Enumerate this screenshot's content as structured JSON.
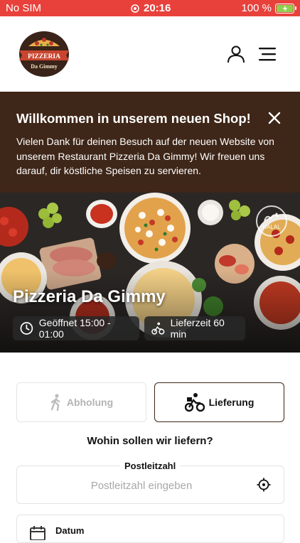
{
  "status_bar": {
    "carrier": "No SIM",
    "time": "20:16",
    "battery": "100 %"
  },
  "header": {
    "logo_top_text": "PIZZERIA",
    "logo_bottom_text": "Da Gimmy"
  },
  "banner": {
    "title": "Willkommen in unserem neuen Shop!",
    "text": "Vielen Dank für deinen Besuch auf der neuen Website von unserem Restaurant Pizzeria Da Gimmy! Wir freuen uns darauf, dir köstliche Speisen zu servieren."
  },
  "hero": {
    "restaurant_name": "Pizzeria Da Gimmy",
    "opening_hours": "Geöffnet 15:00 - 01:00",
    "delivery_time": "Lieferzeit 60 min",
    "badge_text": "HALAL"
  },
  "order_mode": {
    "pickup_label": "Abholung",
    "delivery_label": "Lieferung",
    "selected": "delivery"
  },
  "delivery_question": "Wohin sollen wir liefern?",
  "postal_code": {
    "label": "Postleitzahl",
    "placeholder": "Postleitzahl eingeben",
    "value": ""
  },
  "date_field": {
    "label": "Datum"
  },
  "colors": {
    "status_bar": "#e8413c",
    "brand_brown": "#3e2618",
    "border_light": "#e4e4e4"
  }
}
